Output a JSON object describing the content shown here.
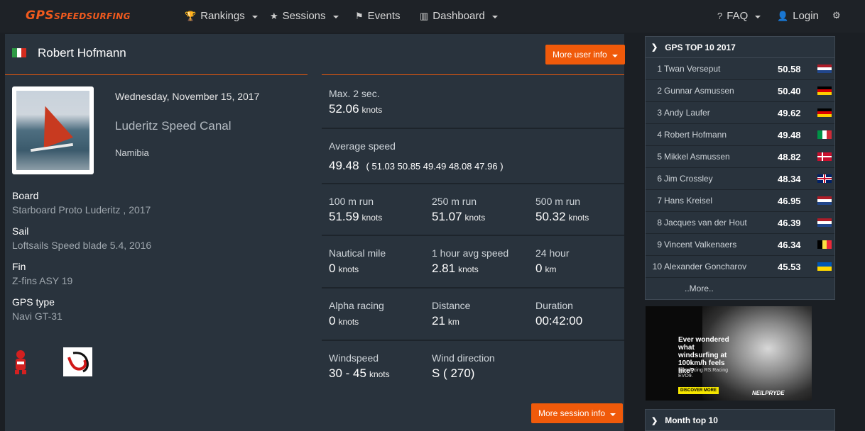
{
  "brand": {
    "main": "GPS",
    "sub": "SPEEDSURFING",
    "color": "#f05a1e"
  },
  "nav": {
    "rankings": "Rankings",
    "sessions": "Sessions",
    "events": "Events",
    "dashboard": "Dashboard",
    "faq": "FAQ",
    "login": "Login"
  },
  "user": {
    "name": "Robert Hofmann",
    "flag": "italy-flag",
    "more_info": "More user info"
  },
  "session": {
    "date": "Wednesday, November 15, 2017",
    "spot": "Luderitz Speed Canal",
    "country": "Namibia",
    "more_info": "More session info"
  },
  "gear": {
    "board_label": "Board",
    "board_value": "Starboard Proto Luderitz , 2017",
    "sail_label": "Sail",
    "sail_value": "Loftsails Speed blade 5.4, 2016",
    "fin_label": "Fin",
    "fin_value": "Z-fins ASY 19",
    "gps_label": "GPS type",
    "gps_value": "Navi GT-31"
  },
  "stats": {
    "max2s": {
      "label": "Max. 2 sec.",
      "value": "52.06",
      "unit": "knots"
    },
    "avg": {
      "label": "Average speed",
      "value": "49.48",
      "list": "( 51.03 50.85 49.49 48.08 47.96 )"
    },
    "run100": {
      "label": "100 m run",
      "value": "51.59",
      "unit": "knots"
    },
    "run250": {
      "label": "250 m run",
      "value": "51.07",
      "unit": "knots"
    },
    "run500": {
      "label": "500 m run",
      "value": "50.32",
      "unit": "knots"
    },
    "nautical": {
      "label": "Nautical mile",
      "value": "0",
      "unit": "knots"
    },
    "hour_avg": {
      "label": "1 hour avg speed",
      "value": "2.81",
      "unit": "knots"
    },
    "hour24": {
      "label": "24 hour",
      "value": "0",
      "unit": "km"
    },
    "alpha": {
      "label": "Alpha racing",
      "value": "0",
      "unit": "knots"
    },
    "distance": {
      "label": "Distance",
      "value": "21",
      "unit": "km"
    },
    "duration": {
      "label": "Duration",
      "value": "00:42:00"
    },
    "windspeed": {
      "label": "Windspeed",
      "value": "30 - 45",
      "unit": "knots"
    },
    "wind_dir": {
      "label": "Wind direction",
      "value": "S ( 270)"
    }
  },
  "top10": {
    "title": "GPS TOP 10 2017",
    "rows": [
      {
        "pos": "1",
        "name": "Twan Verseput",
        "speed": "50.58",
        "flag": "netherlands"
      },
      {
        "pos": "2",
        "name": "Gunnar Asmussen",
        "speed": "50.40",
        "flag": "germany"
      },
      {
        "pos": "3",
        "name": "Andy Laufer",
        "speed": "49.62",
        "flag": "germany"
      },
      {
        "pos": "4",
        "name": "Robert Hofmann",
        "speed": "49.48",
        "flag": "italy"
      },
      {
        "pos": "5",
        "name": "Mikkel Asmussen",
        "speed": "48.82",
        "flag": "denmark"
      },
      {
        "pos": "6",
        "name": "Jim Crossley",
        "speed": "48.34",
        "flag": "uk"
      },
      {
        "pos": "7",
        "name": "Hans Kreisel",
        "speed": "46.95",
        "flag": "netherlands"
      },
      {
        "pos": "8",
        "name": "Jacques van der Hout",
        "speed": "46.39",
        "flag": "netherlands"
      },
      {
        "pos": "9",
        "name": "Vincent Valkenaers",
        "speed": "46.34",
        "flag": "belgium"
      },
      {
        "pos": "10",
        "name": "Alexander Goncharov",
        "speed": "45.53",
        "flag": "ukraine"
      }
    ],
    "more": "..More.."
  },
  "ad": {
    "headline": "Ever wondered what windsurfing at 100km/h feels like?",
    "sub": "Introducing RS:Racing EVO9.",
    "button": "DISCOVER MORE",
    "logo": "NEILPRYDE"
  },
  "month": {
    "title": "Month top 10"
  }
}
